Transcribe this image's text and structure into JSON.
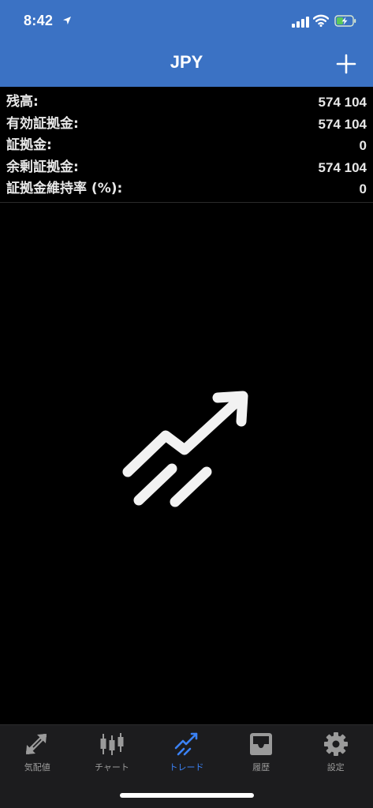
{
  "status_bar": {
    "time": "8:42"
  },
  "nav": {
    "title": "JPY"
  },
  "summary": {
    "rows": [
      {
        "label": "残高:",
        "value": "574 104"
      },
      {
        "label": "有効証拠金:",
        "value": "574 104"
      },
      {
        "label": "証拠金:",
        "value": "0"
      },
      {
        "label": "余剰証拠金:",
        "value": "574 104"
      },
      {
        "label": "証拠金維持率 (%):",
        "value": "0"
      }
    ]
  },
  "tabs": [
    {
      "label": "気配値",
      "icon": "quotes-arrows-icon",
      "active": false
    },
    {
      "label": "チャート",
      "icon": "candlestick-icon",
      "active": false
    },
    {
      "label": "トレード",
      "icon": "trade-trend-icon",
      "active": true
    },
    {
      "label": "履歴",
      "icon": "inbox-history-icon",
      "active": false
    },
    {
      "label": "設定",
      "icon": "gear-icon",
      "active": false
    }
  ],
  "colors": {
    "header": "#3b72c4",
    "background": "#000000",
    "tab_bar": "#1c1c1e",
    "active_tab": "#3b82f6",
    "inactive_tab": "#9a9a9a"
  },
  "empty_state_icon": "trending-up-icon"
}
